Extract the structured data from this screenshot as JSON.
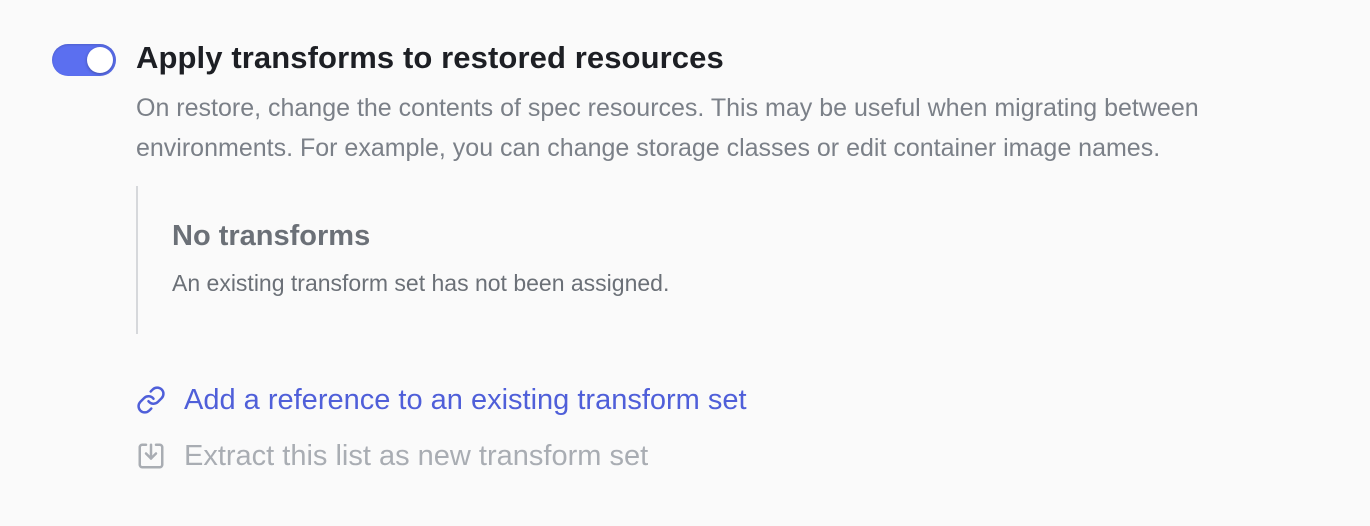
{
  "setting": {
    "toggle_on": true,
    "title": "Apply transforms to restored resources",
    "description": "On restore, change the contents of spec resources. This may be useful when migrating between environments. For example, you can change storage classes or edit container image names."
  },
  "empty_state": {
    "title": "No transforms",
    "message": "An existing transform set has not been assigned."
  },
  "actions": {
    "add_reference": {
      "label": "Add a reference to an existing transform set",
      "icon": "link-icon"
    },
    "extract": {
      "label": "Extract this list as new transform set",
      "icon": "download-icon",
      "disabled": true
    }
  },
  "colors": {
    "accent": "#5b6ff0",
    "link": "#4f5fd9",
    "disabled": "#a9adb3"
  }
}
